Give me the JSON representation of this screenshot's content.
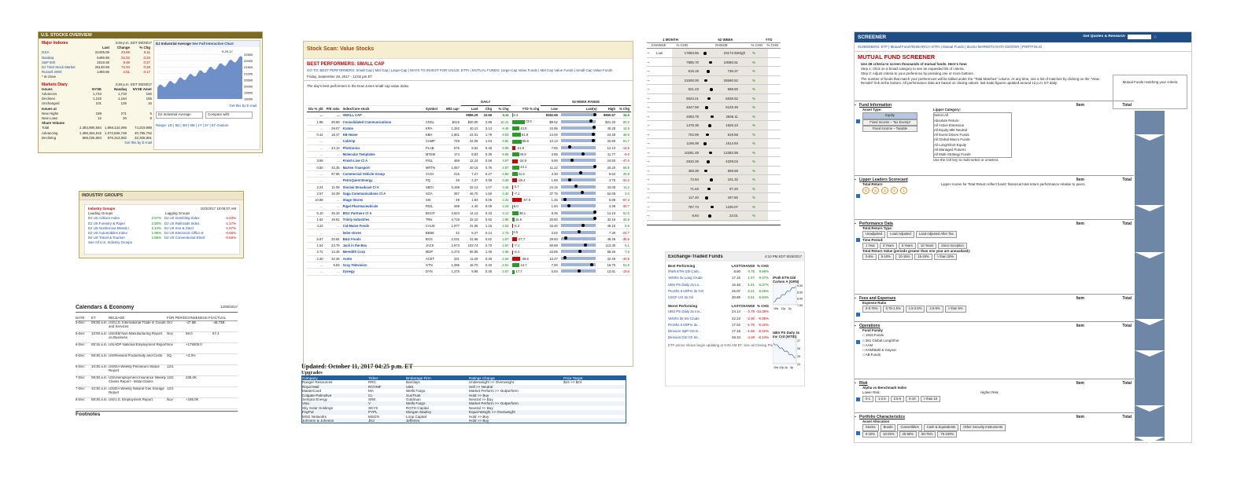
{
  "p1": {
    "title": "U.S. STOCKS OVERVIEW",
    "stamp": "3:49 p.m. EDT 09/29/17",
    "major": "Major Indexes",
    "cols": [
      "Last",
      "Change",
      "% Chg"
    ],
    "rows": [
      [
        "DJIA",
        "22405.09",
        "23.89",
        "0.11"
      ],
      [
        "Nasdaq",
        "6495.96",
        "22.32",
        "0.34"
      ],
      [
        "S&P 500",
        "2519.36",
        "9.48",
        "0.37"
      ],
      [
        "DJ Total Stock Market",
        "26130.59",
        "72.04",
        "0.28"
      ],
      [
        "Russell 2000",
        "1490.86",
        "2.51",
        "0.17"
      ]
    ],
    "closenote": "* at close",
    "chartTitle": "DJ Industrial Average",
    "chartLink": "See Full Interactive Chart",
    "chartStamp": "9-29-17",
    "yticks": [
      "22500",
      "22000",
      "21500",
      "21000",
      "20500",
      "20000",
      "19500",
      "19000"
    ],
    "diary": "Markets Diary",
    "diaryStamp": "3:49 p.m. EDT 09/29/17",
    "diaryCols": [
      "Issues",
      "NYSE",
      "Nasdaq",
      "NYSE Amer"
    ],
    "diaryRows": [
      [
        "Advances",
        "1,743",
        "1,733",
        "160"
      ],
      [
        "Declines",
        "1,215",
        "1,164",
        "155"
      ],
      [
        "Unchanged",
        "101",
        "126",
        "16"
      ]
    ],
    "issuesAt": "Issues at",
    "highRows": [
      [
        "New Highs",
        "159",
        "271",
        "5"
      ],
      [
        "New Lows",
        "12",
        "20",
        "8"
      ]
    ],
    "share": "Share Volume",
    "volRows": [
      [
        "Total",
        "2,384,995,584",
        "1,968,134,095",
        "74,219,988"
      ],
      [
        "Advancing",
        "1,385,364,516",
        "1,072,836,748",
        "40,795,752"
      ],
      [
        "Declining",
        "969,025,984",
        "876,313,082",
        "32,308,861"
      ]
    ],
    "email": "Get this by E-mail",
    "select": "DJ Industrial Average",
    "compare": "Compare with:",
    "range": "Range: 1D | 5D | 3M | 6M | 1Y | 2Y | 5Y Custom"
  },
  "p2": {
    "title": "INDUSTRY GROUPS",
    "sub": "Industry Groups",
    "stamp": "10/3/2017 10:06:07 AM",
    "lead": "Leading Groups",
    "lag": "Lagging Groups",
    "leaders": [
      [
        "DJ US Airlines Index",
        "2.57%"
      ],
      [
        "DJ US Forestry & Paper",
        "2.50%"
      ],
      [
        "DJ US Nonferrous Metals I",
        "2.14%"
      ],
      [
        "DJ US Automobiles Index",
        "1.96%"
      ],
      [
        "DJ US Travel & Tourism",
        "1.56%"
      ]
    ],
    "laggers": [
      [
        "DJ US Gambling Index",
        "-1.53%"
      ],
      [
        "DJ US Railroads Index",
        "-1.17%"
      ],
      [
        "DJ US Iron & Steel",
        "-1.07%"
      ],
      [
        "DJ US Electronic Office E",
        "-0.66%"
      ],
      [
        "DJ US Conventional Electr",
        "-0.66%"
      ]
    ],
    "all": "See All U.S. Industry Groups"
  },
  "p3": {
    "title": "Calendars & Economy",
    "date": "12/05/2017",
    "cols": [
      "DATE",
      "ET",
      "RELEASE",
      "FOR PERIOD",
      "CONSENSUS FORECAST",
      "ACTUAL"
    ],
    "rows": [
      [
        "5-Dec",
        "08:30 a.m.",
        "US/U.S. International Trade in Goods and Services",
        "Oct",
        "-47.5B",
        "-48.73B"
      ],
      [
        "5-Dec",
        "10:00 a.m.",
        "US/ISM Non-Manufacturing Report on Business",
        "Nov",
        "59.0",
        "57.4"
      ],
      [
        "6-Dec",
        "08:15 a.m.",
        "US/ADP National Employment Report",
        "Nov",
        "+175000.0",
        ""
      ],
      [
        "6-Dec",
        "08:30 a.m.",
        "US/Revised Productivity and Costs",
        "3Q",
        "+3.3%",
        ""
      ],
      [
        "6-Dec",
        "10:30 a.m.",
        "US/EIA Weekly Petroleum Status Report",
        "12/1",
        "",
        ""
      ],
      [
        "7-Dec",
        "08:30 a.m.",
        "US/Unemployment Insurance Weekly Claims Report - Initial Claims",
        "12/2",
        "236.0K",
        ""
      ],
      [
        "7-Dec",
        "10:30 a.m.",
        "US/EIA Weekly Natural Gas Storage Report",
        "12/1",
        "",
        ""
      ],
      [
        "8-Dec",
        "08:30 a.m.",
        "US/U.S. Employment Report",
        "Nov",
        "+195.0K",
        ""
      ]
    ],
    "foot": "Footnotes"
  },
  "p4": {
    "title": "Stock Scan: Value Stocks",
    "best": "BEST PERFORMERS: SMALL CAP",
    "goto": "GO TO: BEST PERFORMERS: Small-Cap | Mid-Cap | Large-Cap | WAYS TO INVEST FOR VALUE: ETFs | MUTUAL FUNDS: Large-Cap Value Funds | Mid-Cap Value Funds | Small-Cap Value Funds",
    "date": "Friday, September 29, 2017 - 12:02 pm ET",
    "desc": "The day's best performers in the Dow Jones small-cap value index.",
    "daily": "DAILY",
    "range": "52-WEEK RANGE",
    "cols": [
      "Div % yld",
      "P/E ratio",
      "Index/Core stock",
      "Symbol",
      "Mkt cap¹",
      "Last",
      "Chg",
      "% Chg",
      "YTD % chg",
      "Low",
      "Last(●)",
      "High",
      "% Chg"
    ],
    "rows": [
      [
        "...",
        "...",
        "SMALL CAP",
        "",
        "",
        "9886.29",
        "10.66",
        "0.11",
        "3.4",
        "8282.68",
        "",
        "9860.57",
        "15.0"
      ],
      [
        "1.95",
        "30.60",
        "Consolidated Communications",
        "CNSL",
        "$415",
        "$20.00",
        "2.89",
        "16.41",
        "73.0",
        "$9.52",
        "",
        "$21.40",
        "60.0"
      ],
      [
        "...",
        "29.07",
        "Kraton",
        "KRA",
        "1,152",
        "40.12",
        "3.14",
        "8.49",
        "43.9",
        "24.95",
        "",
        "40.28",
        "14.5"
      ],
      [
        "0.42",
        "18.47",
        "KB Home",
        "KBH",
        "1,901",
        "24.01",
        "1.79",
        "8.06",
        "51.9",
        "14.06",
        "",
        "24.48",
        "48.9"
      ],
      [
        "...",
        "...",
        "CalAmp",
        "CAMP",
        "748",
        "22.06",
        "1.64",
        "6.82",
        "55.6",
        "12.13",
        "",
        "22.59",
        "61.7"
      ],
      [
        "...",
        "44.13",
        "Photronics",
        "PLAB",
        "576",
        "8.62",
        "0.48",
        "5.89",
        "-21.9",
        "7.55",
        "",
        "12.10",
        "-14.6"
      ],
      [
        "...",
        "...",
        "Molecular Templates",
        "MTEM",
        "174",
        "8.83",
        "0.36",
        "5.56",
        "40.6",
        "3.85",
        "",
        "11.77",
        "-9.0"
      ],
      [
        "3.59",
        "...",
        "Finish Line Cl A",
        "FINL",
        "469",
        "12.24",
        "0.58",
        "4.97",
        "-34.9",
        "6.90",
        "",
        "24.50",
        "-47.0"
      ],
      [
        "0.50",
        "32.35",
        "Marten Transport",
        "MRTN",
        "1,057",
        "20.15",
        "0.75",
        "3.87",
        "44.1",
        "11.22",
        "",
        "20.20",
        "59.9"
      ],
      [
        "...",
        "97.85",
        "Commercial Vehicle Group",
        "CVGI",
        "216",
        "7.27",
        "0.27",
        "3.86",
        "31.5",
        "4.30",
        "",
        "9.62",
        "25.8"
      ],
      [
        "...",
        "...",
        "PetroQuest Energy",
        "PQ",
        "49",
        "2.37",
        "0.08",
        "3.49",
        "-28.4",
        "1.66",
        "",
        "4.75",
        "-31.5"
      ],
      [
        "2.24",
        "11.08",
        "Sinclair Broadcast Cl A",
        "SBGI",
        "3,158",
        "32.13",
        "1.07",
        "3.46",
        "-3.7",
        "24.15",
        "",
        "43.05",
        "11.2"
      ],
      [
        "2.57",
        "16.39",
        "Saga Communications Cl A",
        "SGA",
        "267",
        "46.70",
        "1.50",
        "3.32",
        "-7.1",
        "37.75",
        "",
        "52.05",
        "3.0"
      ],
      [
        "10.88",
        "...",
        "Stage Stores",
        "SSI",
        "49",
        "1.84",
        "0.06",
        "3.31",
        "-57.9",
        "1.45",
        "",
        "5.88",
        "-57.3"
      ],
      [
        "...",
        "...",
        "Rigel Pharmaceuticals",
        "RIGL",
        "289",
        "2.40",
        "0.08",
        "3.23",
        "6.0",
        "1.94",
        "",
        "4.38",
        "-34.7"
      ],
      [
        "5.10",
        "35.33",
        "BGC Partners Cl A",
        "BGCP",
        "3,923",
        "14.13",
        "0.43",
        "3.14",
        "38.1",
        "8.36",
        "",
        "14.13",
        "61.0"
      ],
      [
        "1.62",
        "19.81",
        "Trinity Industries",
        "TRN",
        "4,719",
        "32.10",
        "0.92",
        "2.95",
        "15.6",
        "20.80",
        "",
        "32.15",
        "32.8"
      ],
      [
        "4.22",
        "...",
        "Cal-Maine Foods",
        "CALM",
        "1,977",
        "41.65",
        "1.15",
        "2.83",
        "-6.3",
        "33.40",
        "",
        "46.15",
        "8.6"
      ],
      [
        "...",
        "...",
        "bebe stores",
        "BEBE",
        "42",
        "5.27",
        "0.14",
        "2.73",
        "3.5",
        "3.02",
        "",
        "7.30",
        "-24.7"
      ],
      [
        "5.87",
        "20.84",
        "B&G Foods",
        "BGS",
        "2,031",
        "31.68",
        "0.82",
        "2.67",
        "-27.7",
        "29.50",
        "",
        "49.49",
        "-35.6"
      ],
      [
        "1.54",
        "23.79",
        "Jack in the Box",
        "JACK",
        "2,973",
        "103.74",
        "2.70",
        "2.67",
        "-7.1",
        "80.89",
        "",
        "113.30",
        "8.1"
      ],
      [
        "3.72",
        "13.45",
        "Meredith Corp",
        "MDP",
        "2,473",
        "55.95",
        "1.45",
        "2.66",
        "-6.4",
        "43.85",
        "",
        "66.25",
        "7.6"
      ],
      [
        "2.30",
        "32.26",
        "Aceto",
        "ACET",
        "331",
        "11.29",
        "0.29",
        "2.64",
        "-48.6",
        "10.27",
        "",
        "22.46",
        "-40.5"
      ],
      [
        "...",
        "9.83",
        "Gray Television",
        "GTN",
        "1,096",
        "15.70",
        "0.40",
        "2.61",
        "44.7",
        "7.00",
        "",
        "16.70",
        "51.5"
      ],
      [
        "...",
        "...",
        "Dynegy",
        "DYN",
        "1,275",
        "9.96",
        "0.25",
        "2.57",
        "17.7",
        "5.84",
        "",
        "13.81",
        "-19.6"
      ]
    ]
  },
  "p5": {
    "updated": "Updated: October 11, 2017 04:25 p.m. ET",
    "upgrades": "Upgrades",
    "cols": [
      "Company",
      "Ticker",
      "Brokerage Firm",
      "Ratings Change",
      "Price Target"
    ],
    "rows": [
      [
        "Ranger Resources",
        "RRC",
        "Barclays",
        "Underweight >> Overweight",
        "$16 >> $24"
      ],
      [
        "Royal Mail",
        "ROYMF",
        "UBS",
        "Sell >> Neutral",
        ""
      ],
      [
        "MasterCard",
        "MA",
        "Wells Fargo",
        "Market Perform >> Outperform",
        ""
      ],
      [
        "Colgate-Palmolive",
        "CL",
        "SunTrust",
        "Hold >> Buy",
        ""
      ],
      [
        "Sempra Energy",
        "SRE",
        "Goldman",
        "Neutral >> Buy",
        ""
      ],
      [
        "Visa",
        "V",
        "Wells Fargo",
        "Market Perform >> Outperform",
        ""
      ],
      [
        "Sky Solar Holdings",
        "SKYS",
        "ROTH Capital",
        "Neutral >> Buy",
        ""
      ],
      [
        "PayPal",
        "PYPL",
        "Morgan Stanley",
        "Equal-Weight >> Overweight",
        ""
      ],
      [
        "MSG Networks",
        "MSGN",
        "Loop Capital",
        "Hold >> Buy",
        ""
      ],
      [
        "Johnson & Johnson",
        "JNJ",
        "Jefferies",
        "Hold >> Buy",
        ""
      ]
    ]
  },
  "p6": {
    "h1": "1 MONTH",
    "h2": "52 WEEK",
    "h3": "YTD",
    "cols": [
      "CHANGE",
      "% CHG",
      "RANGE",
      "% CHG",
      "% CHG"
    ],
    "rows": [
      [
        "Low",
        "17883.56",
        "23172.93",
        "High"
      ],
      [
        "",
        "7885.70",
        "10080.51",
        ""
      ],
      [
        "",
        "616.19",
        "735.37",
        ""
      ],
      [
        "",
        "21500.00",
        "26590.52",
        ""
      ],
      [
        "",
        "521.23",
        "688.50",
        ""
      ],
      [
        "",
        "5634.41",
        "6635.52",
        ""
      ],
      [
        "",
        "4647.59",
        "6129.49",
        ""
      ],
      [
        "",
        "2083.79",
        "2566.11",
        ""
      ],
      [
        "",
        "1475.38",
        "1626.23",
        ""
      ],
      [
        "",
        "702.99",
        "919.56",
        ""
      ],
      [
        "",
        "1196.08",
        "1514.94",
        ""
      ],
      [
        "",
        "10281.48",
        "12382.59",
        ""
      ],
      [
        "",
        "2632.26",
        "4329.04",
        ""
      ],
      [
        "",
        "458.39",
        "559.59",
        ""
      ],
      [
        "",
        "72.84",
        "101.32",
        ""
      ],
      [
        "",
        "71.63",
        "97.20",
        ""
      ],
      [
        "",
        "117.40",
        "197.50",
        ""
      ],
      [
        "",
        "787.74",
        "1230.07",
        ""
      ],
      [
        "",
        "8.84",
        "23.01",
        ""
      ]
    ]
  },
  "p7": {
    "title": "Exchange-Traded Funds",
    "stamp": "4:10 PM EDT 9/25/2017",
    "best": "Best Performing",
    "worst": "Worst Performing",
    "cols": [
      "LAST",
      "CHANGE",
      "% CHG"
    ],
    "bestRows": [
      [
        "iPath ETN Gbl Carb...",
        "8.60",
        "0.76",
        "9.69%"
      ],
      [
        "VelShs 3x Long Crude",
        "17.16",
        "1.47",
        "9.37%"
      ],
      [
        "UBS PS Daily 3x Ln...",
        "16.46",
        "1.41",
        "9.37%"
      ],
      [
        "ProShs II UltPro 3x CO",
        "26.07",
        "2.21",
        "9.26%"
      ],
      [
        "USCF US 3x Oil",
        "30.89",
        "2.51",
        "8.84%"
      ]
    ],
    "worstRows": [
      [
        "UBS PS Daily 3x Inv...",
        "24.14",
        "-2.79",
        "-10.36%"
      ],
      [
        "VelShs 3x Inv Crude",
        "22.23",
        "-2.30",
        "-9.38%"
      ],
      [
        "ProShs II UltPro 3x...",
        "17.02",
        "-1.75",
        "-9.32%"
      ],
      [
        "Direxion S&P OG E...",
        "17.19",
        "-1.56",
        "-8.32%"
      ],
      [
        "Direxion:CSI Ch Int...",
        "48.34",
        "-4.28",
        "-8.13%"
      ]
    ],
    "chart1": "iPath ETN Gbl Carbon A (GRN)",
    "chart2": "UBS PS Daily 3x Inv Crd (WTID)",
    "t1": [
      "10a",
      "12p",
      "2p"
    ],
    "t2": [
      "10a",
      "12p",
      "2p",
      "4p"
    ],
    "y1": [
      "9.00",
      "8.50",
      "8.00",
      "7.50"
    ],
    "y2": [
      "27",
      "26",
      "25",
      "24"
    ],
    "note": "ETF prices shown begin updating at 9:45 AM ET. See all Closing Prices."
  },
  "p8": {
    "title": "SCREENER",
    "quote": "Get Quotes & Research",
    "nav": "SCREENERS: ETF | Mutual Fund    RESEARCH: ETFs | Mutual Funds | Stocks    MARKETS DATA CENTER | PORTFOLIO",
    "mtitle": "MUTUAL FUND SCREENER",
    "intro": "Use 38 criteria to screen thousands of mutual funds. Here's how:",
    "s1": "Step 1: Click on a broad category to see an expanded list of criteria.",
    "s2": "Step 2: Adjust criteria to your preference by pressing one or more buttons.",
    "note": "The number of funds that match your preferences will be tallied under the \"Total Matches\" column. At any time, see a list of matches by clicking on the \"View Results\" link at the bottom. All performance data are based on closing values; last trade figures updated around 12 p.m. ET daily.",
    "matching": "Mutual Funds matching your criteria",
    "fundinfo": "Fund Information",
    "assetType": "Asset Type:",
    "assets": [
      "Equity",
      "Fixed Income – Tax Exempt",
      "Fixed Income – Taxable"
    ],
    "lipper": "Lipper Category:",
    "lipperList": [
      "Select All",
      "Absolute Return",
      "All Active Extension",
      "All Equity Mkt Neutral",
      "All Event Driven Funds",
      "All Global Macro Funds",
      "All Long/Short Equity",
      "All Managed Futures",
      "All Multi-Strategy Funds"
    ],
    "ctrl": "Use the Ctrl key to multi-select or unselect.",
    "leaders": "Lipper Leaders Scorecard",
    "about": "About Lipper Leaders",
    "totret": "Total Return",
    "leadNote": "Lipper scores for Total Return reflect funds' historical total return performance relative to peers.",
    "perf": "Performance Data",
    "trType": "Total Return Type:",
    "trTypes": [
      "Unadjusted",
      "Load Adjusted",
      "Load Adjusted After Tax"
    ],
    "period": "Time Period:",
    "periods": [
      "1 Year",
      "3 Years",
      "5 Years",
      "10 Years",
      "Since Inception"
    ],
    "trv": "Total Return Value (periods greater than one year are annualized):",
    "trvs": [
      "0-5%",
      "5-10%",
      "10-15%",
      "15-20%",
      "> than 20%"
    ],
    "fees": "Fees and Expenses",
    "expense": "Expense Ratio",
    "exps": [
      "0-0.75%",
      "0.75-1.5%",
      "1.5-2.5%",
      "2.5-5%",
      "> than 5%"
    ],
    "ops": "Operations",
    "family": "Fund Family",
    "families": [
      "1919 Funds",
      "361 Global Long/Shor",
      "AAM",
      "AAM/Bahl & Gaynor",
      "AB Funds"
    ],
    "risk": "Risk",
    "alpha": "Alpha vs Benchmark Index",
    "lower": "Lower Risk",
    "higher": "Higher Risk",
    "risks": [
      "0-1",
      "1-2.5",
      "2.5-5",
      "5-10",
      "> than 10"
    ],
    "port": "Portfolio Characteristics",
    "alloc": "Asset Allocation",
    "allocs": [
      "Stocks",
      "Bonds",
      "Convertibles",
      "Cash & Equivalents",
      "Other Security Instruments"
    ],
    "pcts": [
      "5-10%",
      "10-25%",
      "25-50%",
      "50-75%",
      "75-100%"
    ],
    "item": "Item",
    "total": "Total",
    "groups": "groups"
  },
  "colors": {
    "gold": "#b9a75c",
    "blue": "#1f4d86",
    "red": "#cc0000",
    "green": "#008800",
    "steel": "#6e87a6"
  }
}
